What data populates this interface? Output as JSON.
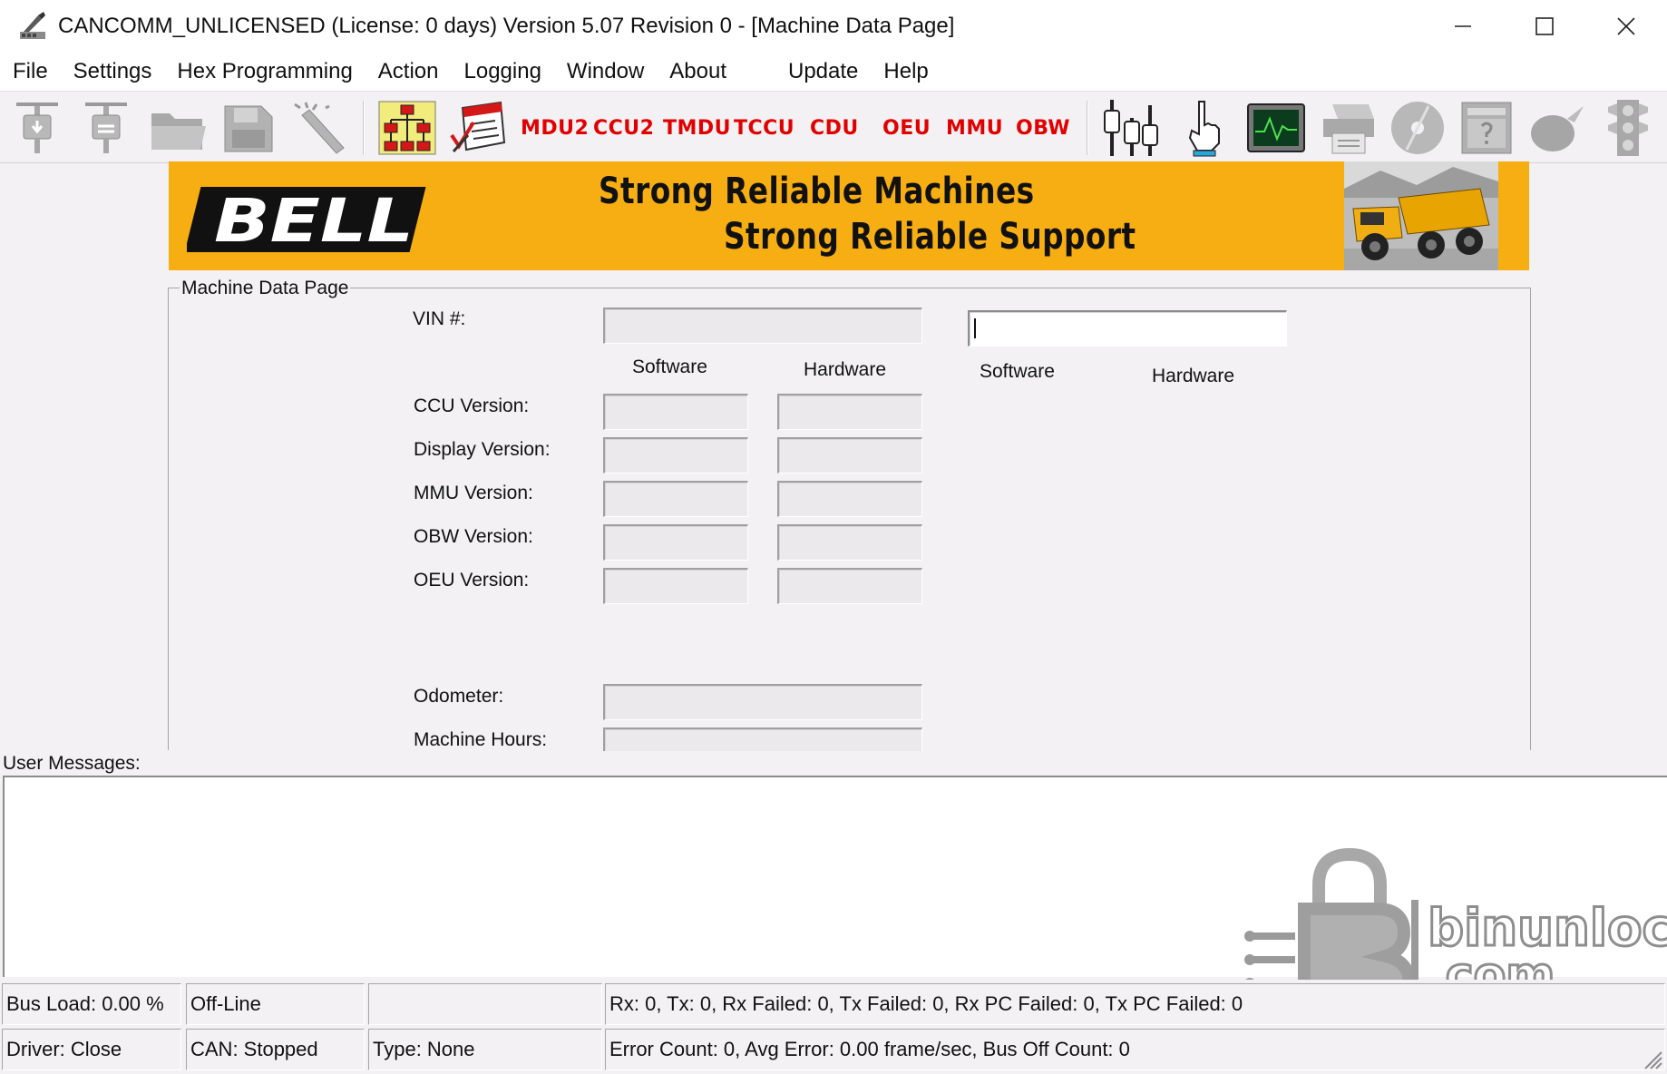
{
  "window": {
    "title": "CANCOMM_UNLICENSED (License: 0 days) Version 5.07 Revision 0 - [Machine Data Page]",
    "minimize": "—",
    "maximize": "☐",
    "close": "✕"
  },
  "menu": {
    "file": "File",
    "settings": "Settings",
    "hex_programming": "Hex Programming",
    "action": "Action",
    "logging": "Logging",
    "window": "Window",
    "about": "About",
    "update": "Update",
    "help": "Help"
  },
  "toolbar": {
    "modules": [
      "MDU2",
      "CCU2",
      "TMDU",
      "TCCU",
      "CDU",
      "OEU",
      "MMU",
      "OBW"
    ],
    "module_color": "#e10000",
    "icons": [
      "connect-icon",
      "disconnect-icon",
      "open-folder-icon",
      "save-icon",
      "magic-wand-icon",
      "network-icon",
      "checklist-icon",
      "valves-icon",
      "hand-pointer-icon",
      "monitor-icon",
      "print-icon",
      "disc-icon",
      "calculator-icon",
      "apple-icon",
      "traffic-light-icon"
    ]
  },
  "banner": {
    "brand": "BELL",
    "slogan_line1": "Strong Reliable Machines",
    "slogan_line2": "Strong Reliable Support",
    "background": "#f6ae12"
  },
  "machine_data": {
    "group_title": "Machine Data Page",
    "vin_label": "VIN #:",
    "vin_value": "",
    "vin_input_value": "",
    "software_header": "Software",
    "hardware_header": "Hardware",
    "software_header2": "Software",
    "hardware_header2": "Hardware",
    "versions": [
      {
        "label": "CCU Version:",
        "software": "",
        "hardware": ""
      },
      {
        "label": "Display Version:",
        "software": "",
        "hardware": ""
      },
      {
        "label": "MMU Version:",
        "software": "",
        "hardware": ""
      },
      {
        "label": "OBW Version:",
        "software": "",
        "hardware": ""
      },
      {
        "label": "OEU Version:",
        "software": "",
        "hardware": ""
      }
    ],
    "odometer_label": "Odometer:",
    "odometer_value": "",
    "machine_hours_label": "Machine Hours:",
    "machine_hours_value": ""
  },
  "messages": {
    "label": "User Messages:",
    "content": ""
  },
  "watermark": {
    "line1": "binunlock",
    "line2": ".com"
  },
  "status": {
    "bus_load": "Bus Load: 0.00 %",
    "line_state": "Off-Line",
    "empty": "",
    "counters": "Rx: 0, Tx: 0, Rx Failed: 0, Tx Failed: 0, Rx PC Failed: 0, Tx PC Failed: 0",
    "driver": "Driver: Close",
    "can": "CAN: Stopped",
    "type": "Type: None",
    "errors": "Error Count: 0, Avg Error: 0.00 frame/sec, Bus Off Count: 0"
  }
}
